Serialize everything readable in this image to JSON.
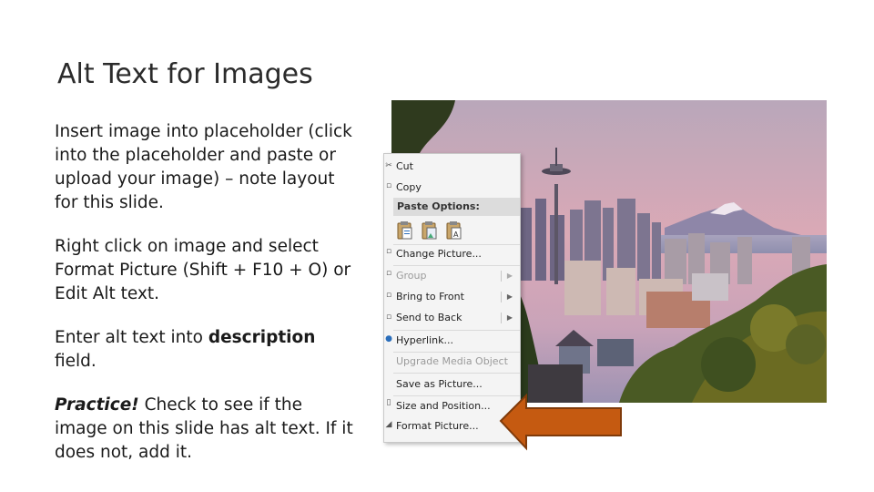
{
  "slide": {
    "title": "Alt Text for Images",
    "paragraphs": [
      {
        "text": "Insert image into placeholder (click into the placeholder and paste or upload your image) – note layout for this slide."
      },
      {
        "text": "Right click on image and select Format Picture (Shift + F10 + O) or Edit Alt text."
      },
      {
        "pre": "Enter alt text into ",
        "bold": "description",
        "post": " field."
      },
      {
        "italic_bold": "Practice!",
        "post": " Check to see if the image on this slide has alt text. If it does not, add it."
      }
    ]
  },
  "context_menu": {
    "items": [
      {
        "label": "Cut",
        "enabled": true
      },
      {
        "label": "Copy",
        "enabled": true
      },
      {
        "label": "Paste Options:",
        "header": true
      },
      {
        "label": "Change Picture...",
        "enabled": true
      },
      {
        "label": "Group",
        "enabled": false,
        "submenu": true
      },
      {
        "label": "Bring to Front",
        "enabled": true,
        "submenu": true
      },
      {
        "label": "Send to Back",
        "enabled": true,
        "submenu": true
      },
      {
        "label": "Hyperlink...",
        "enabled": true
      },
      {
        "label": "Upgrade Media Object",
        "enabled": false
      },
      {
        "label": "Save as Picture...",
        "enabled": true
      },
      {
        "label": "Size and Position...",
        "enabled": true
      },
      {
        "label": "Format Picture...",
        "enabled": true
      }
    ],
    "paste_icons": [
      "paste-keep-formatting-icon",
      "paste-picture-icon",
      "paste-text-icon"
    ]
  },
  "colors": {
    "arrow_fill": "#c55a11",
    "arrow_stroke": "#7f3a0a",
    "menu_bg": "#f4f4f4",
    "paste_header_bg": "#dcdcdc"
  },
  "image": {
    "subject": "photo-seattle-skyline-space-needle"
  }
}
